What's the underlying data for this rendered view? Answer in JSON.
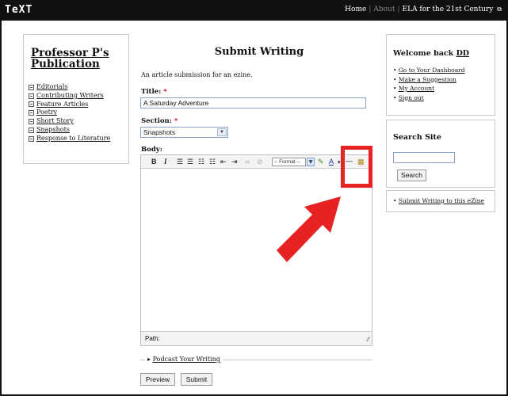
{
  "header": {
    "brand": "TeXT",
    "nav": [
      "Home",
      "About",
      "ELA for the 21st Century"
    ],
    "nav_separator": "|",
    "external_icon": "⧉"
  },
  "sidebar": {
    "title": "Professor P's Publication",
    "items": [
      {
        "label": "Editorials"
      },
      {
        "label": "Contributing Writers"
      },
      {
        "label": "Feature Articles"
      },
      {
        "label": "Poetry"
      },
      {
        "label": "Short Story"
      },
      {
        "label": "Snapshots"
      },
      {
        "label": "Response to Literature"
      }
    ]
  },
  "main": {
    "title": "Submit Writing",
    "description": "An article submission for an ezine.",
    "title_field": {
      "label": "Title:",
      "required_mark": "*",
      "value": "A Saturday Adventure"
    },
    "section_field": {
      "label": "Section:",
      "required_mark": "*",
      "value": "Snapshots"
    },
    "body_label": "Body:",
    "editor": {
      "toolbar": {
        "bold": "B",
        "italic": "I",
        "format_select": "-- Format --"
      },
      "path_label": "Path:"
    },
    "podcast_link": "Podcast Your Writing",
    "buttons": {
      "preview": "Preview",
      "submit": "Submit"
    }
  },
  "right": {
    "welcome": {
      "title_prefix": "Welcome back",
      "username": "DD",
      "links": [
        "Go to Your Dashboard",
        "Make a Suggestion",
        "My Account",
        "Sign out"
      ]
    },
    "search": {
      "title": "Search Site",
      "button": "Search",
      "value": ""
    },
    "submit_link": "Submit Writing to this eZine"
  },
  "colors": {
    "topbar": "#111111",
    "annotation_red": "#e62222",
    "input_border": "#8aa2c7"
  }
}
